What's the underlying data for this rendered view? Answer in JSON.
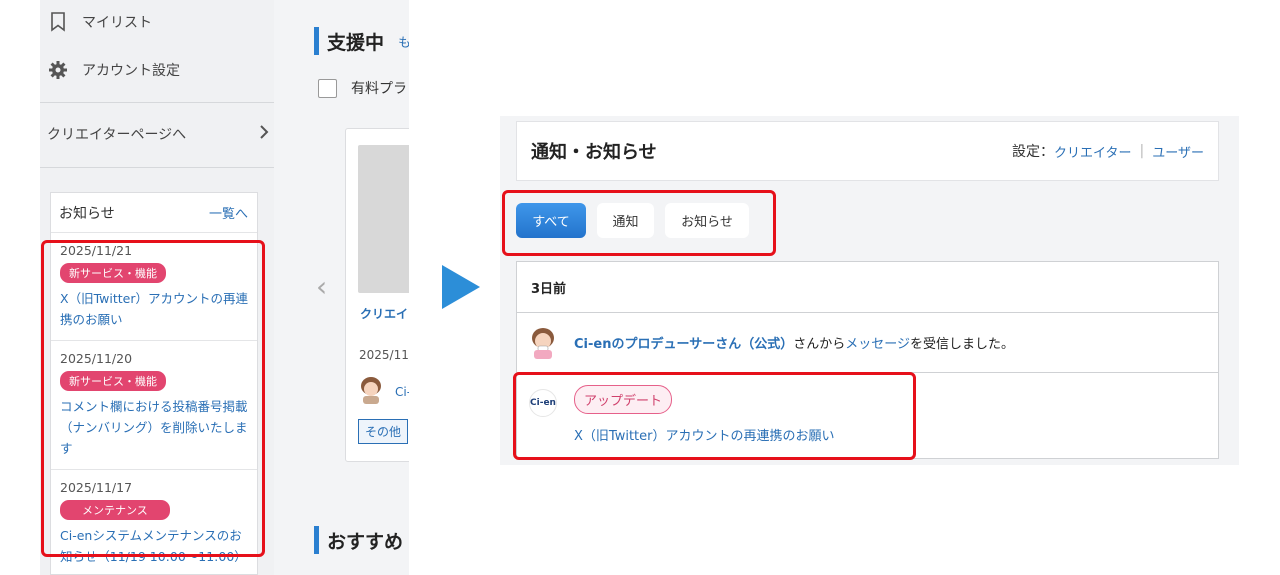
{
  "sidebar": {
    "items": [
      {
        "label": "マイリスト",
        "icon": "bookmark-icon"
      },
      {
        "label": "アカウント設定",
        "icon": "gear-icon"
      }
    ],
    "creator_link": "クリエイターページへ"
  },
  "news_panel": {
    "title": "お知らせ",
    "view_all": "一覧へ",
    "items": [
      {
        "date": "2025/11/21",
        "badge": "新サービス・機能",
        "text": "X（旧Twitter）アカウントの再連携のお願い"
      },
      {
        "date": "2025/11/20",
        "badge": "新サービス・機能",
        "text": "コメント欄における投稿番号掲載（ナンバリング）を削除いたします"
      },
      {
        "date": "2025/11/17",
        "badge": "メンテナンス",
        "text": "Ci-enシステムメンテナンスのお知らせ（11/19 10:00〜11:00）"
      }
    ]
  },
  "main": {
    "supporting_title": "支援中",
    "more_label": "も",
    "paid_filter_label": "有料プラ",
    "card": {
      "title": "クリエイ",
      "date": "2025/11/",
      "author": "Ci-",
      "tag": "その他"
    },
    "recommend_title": "おすすめ"
  },
  "notifications": {
    "title": "通知・お知らせ",
    "settings_label": "設定：",
    "settings_creator": "クリエイター",
    "settings_divider": "|",
    "settings_user": "ユーザー",
    "tabs": [
      "すべて",
      "通知",
      "お知らせ"
    ],
    "group_label": "3日前",
    "message_row": {
      "sender": "Ci-enのプロデューサーさん（公式）",
      "middle": "さんから",
      "link": "メッセージ",
      "suffix": "を受信しました。"
    },
    "update_row": {
      "logo": "Ci-en",
      "badge": "アップデート",
      "link": "X（旧Twitter）アカウントの再連携のお願い"
    }
  },
  "colors": {
    "accent_blue": "#2a7fd0",
    "link_blue": "#2a6fb5",
    "badge_pink": "#e2456f",
    "highlight_red": "#e6101a",
    "arrow_blue": "#2c8ed8"
  }
}
